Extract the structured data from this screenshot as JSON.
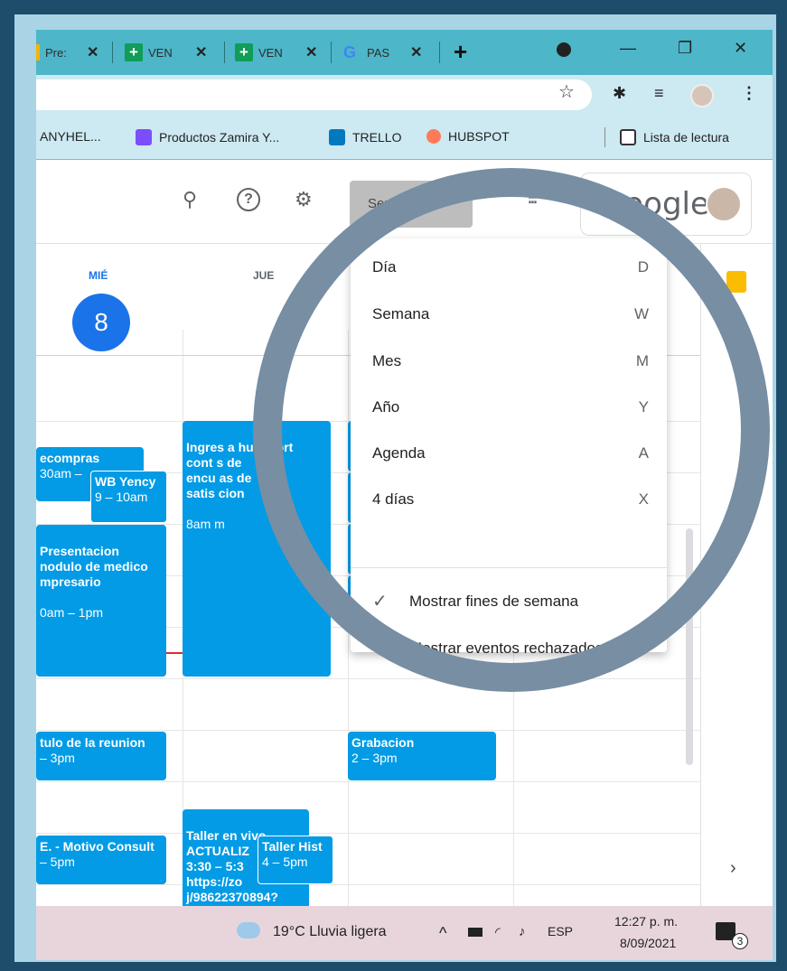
{
  "tabs": [
    {
      "label": "Pre:",
      "icon": "doc-icon"
    },
    {
      "label": "VEN",
      "icon": "sheets-icon"
    },
    {
      "label": "VEN",
      "icon": "sheets-icon"
    },
    {
      "label": "PAS",
      "icon": "google-icon"
    }
  ],
  "bookmarks": [
    {
      "label": "ANYHEL..."
    },
    {
      "label": "Productos Zamira Y..."
    },
    {
      "label": "TRELLO"
    },
    {
      "label": "HUBSPOT"
    },
    {
      "label": "Lista de lectura"
    }
  ],
  "header": {
    "view_button": "Semana",
    "google": "Google"
  },
  "calendar": {
    "col1_day": "MIÉ",
    "col1_num": "8",
    "col2_day": "JUE"
  },
  "events": {
    "e1_title": "ecompras",
    "e1_time": "30am –",
    "e2_title": "WB Yency",
    "e2_time": "9 – 10am",
    "e3_title": "Presentacion\nnodulo de medico\nmpresario",
    "e3_time": "0am – 1pm",
    "e4_title": "Ingres a hubsport\ncont s de\nencu as de\nsatis cion",
    "e4_time": "8am m",
    "e5_title": "tulo de la reunion",
    "e5_time": "– 3pm",
    "e6_title": "Grabacion",
    "e6_time": "2 – 3pm",
    "e7_title": "E. - Motivo Consult",
    "e7_time": "– 5pm",
    "e8_title": "Taller en vivo -\nACTUALIZ\n3:30 – 5:3\nhttps://zo\nj/98622370894?",
    "e9_title": "Taller Hist",
    "e9_time": "4 – 5pm"
  },
  "menu": {
    "items": [
      {
        "label": "Día",
        "key": "D"
      },
      {
        "label": "Semana",
        "key": "W"
      },
      {
        "label": "Mes",
        "key": "M"
      },
      {
        "label": "Año",
        "key": "Y"
      },
      {
        "label": "Agenda",
        "key": "A"
      },
      {
        "label": "4 días",
        "key": "X"
      }
    ],
    "checks": [
      {
        "label": "Mostrar fines de semana"
      },
      {
        "label": "Mostrar eventos rechazados"
      }
    ]
  },
  "taskbar": {
    "weather": "19°C  Lluvia ligera",
    "lang": "ESP",
    "time": "12:27 p. m.",
    "date": "8/09/2021",
    "notif": "3"
  }
}
